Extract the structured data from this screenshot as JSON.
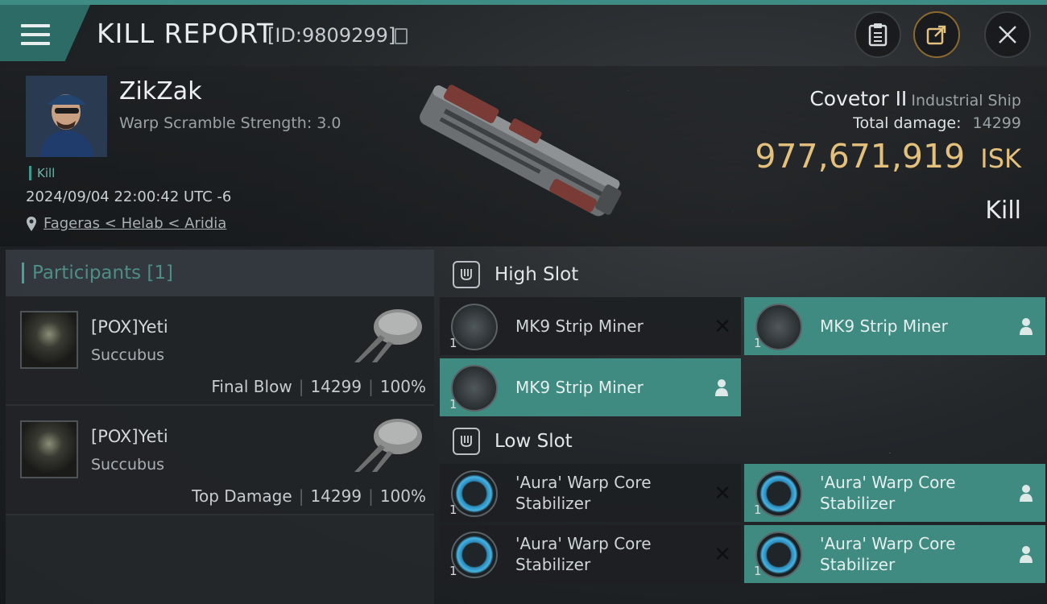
{
  "header": {
    "title": "KILL REPORT",
    "report_id": "[ID:9809299]"
  },
  "victim": {
    "name": "ZikZak",
    "warp_scramble": "Warp Scramble Strength: 3.0",
    "kill_tag": "Kill",
    "datetime": "2024/09/04 22:00:42 UTC -6",
    "location": "Fageras < Helab < Aridia",
    "ship_name": "Covetor II",
    "ship_class": "Industrial Ship",
    "total_damage_label": "Total damage:",
    "total_damage": "14299",
    "isk_value": "977,671,919",
    "isk_unit": "ISK",
    "result": "Kill"
  },
  "participants": {
    "title": "Participants [1]",
    "rows": [
      {
        "name": "[POX]Yeti",
        "ship": "Succubus",
        "role": "Final Blow",
        "damage": "14299",
        "percent": "100%"
      },
      {
        "name": "[POX]Yeti",
        "ship": "Succubus",
        "role": "Top Damage",
        "damage": "14299",
        "percent": "100%"
      }
    ]
  },
  "high_slot": {
    "title": "High Slot",
    "modules": [
      {
        "name": "MK9 Strip Miner",
        "qty": "1",
        "state": "destroyed"
      },
      {
        "name": "MK9 Strip Miner",
        "qty": "1",
        "state": "dropped"
      },
      {
        "name": "MK9 Strip Miner",
        "qty": "1",
        "state": "dropped"
      }
    ]
  },
  "low_slot": {
    "title": "Low Slot",
    "modules": [
      {
        "name1": "'Aura' Warp Core",
        "name2": "Stabilizer",
        "qty": "1",
        "state": "destroyed"
      },
      {
        "name1": "'Aura' Warp Core",
        "name2": "Stabilizer",
        "qty": "1",
        "state": "dropped"
      },
      {
        "name1": "'Aura' Warp Core",
        "name2": "Stabilizer",
        "qty": "1",
        "state": "destroyed"
      },
      {
        "name1": "'Aura' Warp Core",
        "name2": "Stabilizer",
        "qty": "1",
        "state": "dropped"
      }
    ]
  },
  "colors": {
    "accent": "#3f8b82",
    "isk": "#e3c07c"
  },
  "icons": {
    "menu": "hamburger-icon",
    "copy": "copy-icon",
    "clipboard": "clipboard-icon",
    "share": "share-icon",
    "close": "close-icon",
    "location": "location-pin-icon",
    "slot": "slot-icon",
    "destroyed": "x-icon",
    "dropped": "person-icon"
  }
}
